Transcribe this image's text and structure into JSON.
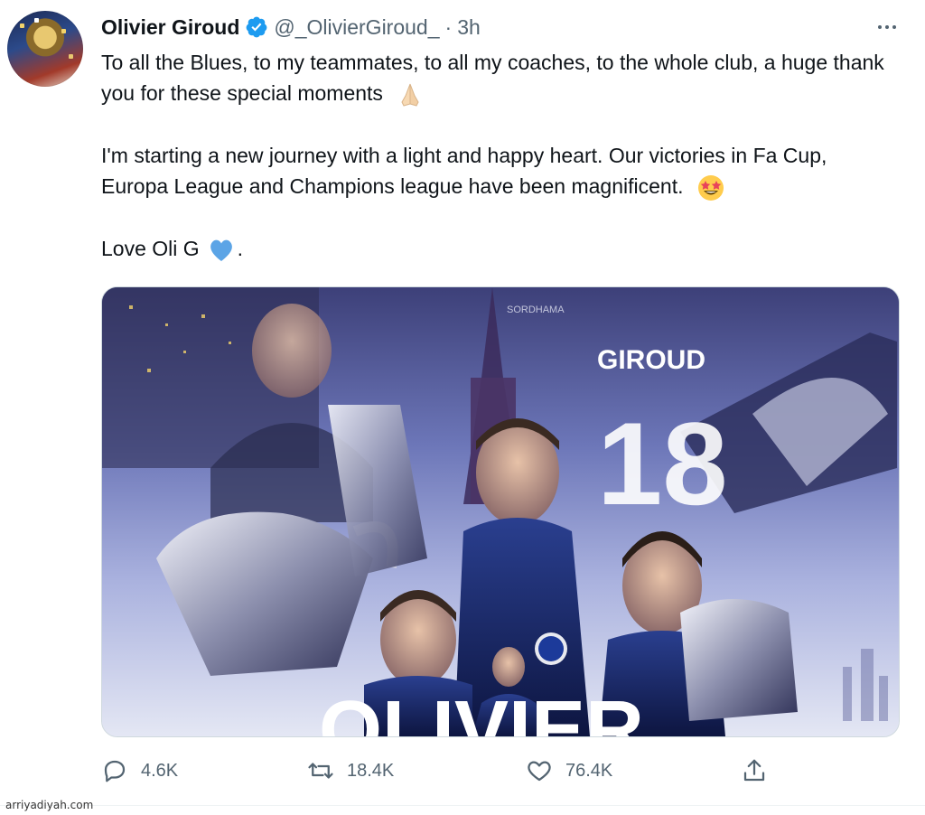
{
  "tweet": {
    "author": {
      "name": "Olivier Giroud",
      "handle": "@_OlivierGiroud_",
      "separator": "·",
      "time": "3h",
      "verified": true
    },
    "text": {
      "p1_line": "To all the Blues, to my teammates, to all my coaches, to the whole club, a huge thank you for these special moments",
      "p1_emoji": "folded-hands",
      "p2_line": "I'm starting a new journey with a light and happy heart. Our victories in Fa Cup, Europa League and Champions league have been magnificent.",
      "p2_emoji": "star-struck",
      "p3_line": "Love Oli G",
      "p3_emoji": "blue-heart",
      "p3_end": "."
    },
    "media": {
      "type": "image",
      "overlay_name": "GIROUD",
      "overlay_number": "18",
      "overlay_small": "SORDHAMA",
      "overlay_bottom": "OLIVIER"
    },
    "actions": {
      "reply_count": "4.6K",
      "retweet_count": "18.4K",
      "like_count": "76.4K"
    }
  },
  "watermark": "arriyadiyah.com",
  "colors": {
    "accent": "#1d9bf0",
    "secondary_text": "#536471",
    "primary_text": "#0f1419",
    "heart_emoji": "#5ba4e6"
  }
}
